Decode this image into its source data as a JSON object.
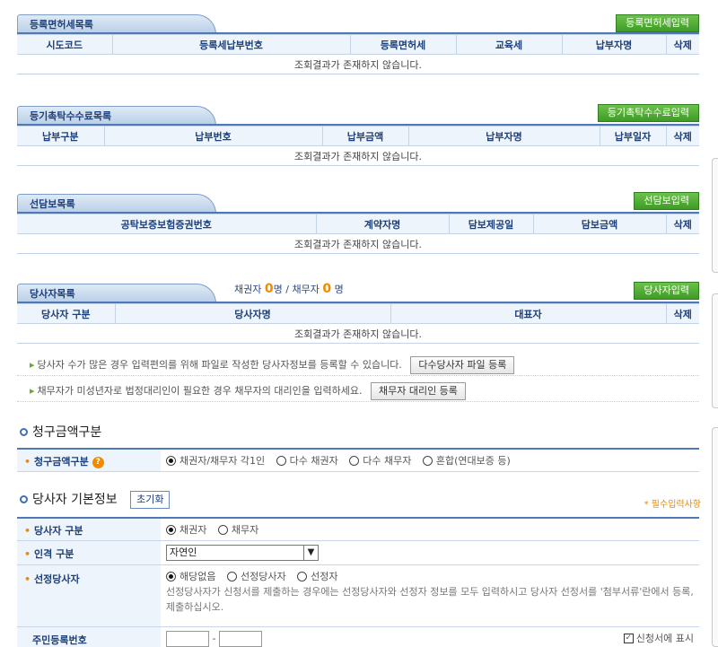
{
  "registration_tax": {
    "title": "등록면허세목록",
    "add_button": "등록면허세입력",
    "columns": [
      "시도코드",
      "등록세납부번호",
      "등록면허세",
      "교육세",
      "납부자명",
      "삭제"
    ],
    "empty": "조회결과가 존재하지 않습니다."
  },
  "registry_fee": {
    "title": "등기촉탁수수료목록",
    "add_button": "등기촉탁수수료입력",
    "columns": [
      "납부구분",
      "납부번호",
      "납부금액",
      "납부자명",
      "납부일자",
      "삭제"
    ],
    "empty": "조회결과가 존재하지 않습니다."
  },
  "pre_security": {
    "title": "선담보목록",
    "add_button": "선담보입력",
    "columns": [
      "공탁보증보험증권번호",
      "계약자명",
      "담보제공일",
      "담보금액",
      "삭제"
    ],
    "empty": "조회결과가 존재하지 않습니다."
  },
  "parties": {
    "title": "당사자목록",
    "count_creditor_label": "채권자",
    "count_creditor": "0",
    "count_unit": "명",
    "count_sep": "/",
    "count_debtor_label": "채무자",
    "count_debtor": "0",
    "add_button": "당사자입력",
    "columns": [
      "당사자 구분",
      "당사자명",
      "대표자",
      "삭제"
    ],
    "empty": "조회결과가 존재하지 않습니다.",
    "note1": "당사자 수가 많은 경우 입력편의를 위해 파일로 작성한 당사자정보를 등록할 수 있습니다.",
    "note1_button": "다수당사자 파일 등록",
    "note2": "채무자가 미성년자로 법정대리인이 필요한 경우 채무자의 대리인을 입력하세요.",
    "note2_button": "채무자 대리인 등록"
  },
  "claim_type": {
    "heading": "청구금액구분",
    "label": "청구금액구분",
    "options": [
      "채권자/채무자 각1인",
      "다수 채권자",
      "다수 채무자",
      "혼합(연대보증 등)"
    ],
    "selected": 0
  },
  "party_info": {
    "heading": "당사자 기본정보",
    "reset_button": "초기화",
    "required_note": "* 필수입력사항",
    "party_type_label": "당사자 구분",
    "party_type_options": [
      "채권자",
      "채무자"
    ],
    "person_type_label": "인격 구분",
    "person_type_value": "자연인",
    "selected_party_label": "선정당사자",
    "selected_party_options": [
      "해당없음",
      "선정당사자",
      "선정자"
    ],
    "selected_party_desc": "선정당사자가 신청서를 제출하는 경우에는 선정당사자와 선정자 정보를 모두 입력하시고 당사자 선정서를 '첨부서류'란에서 등록, 제출하십시오.",
    "rrn_label": "주민등록번호",
    "rrn_sep": "-",
    "show_on_form_label": "신청서에 표시"
  }
}
